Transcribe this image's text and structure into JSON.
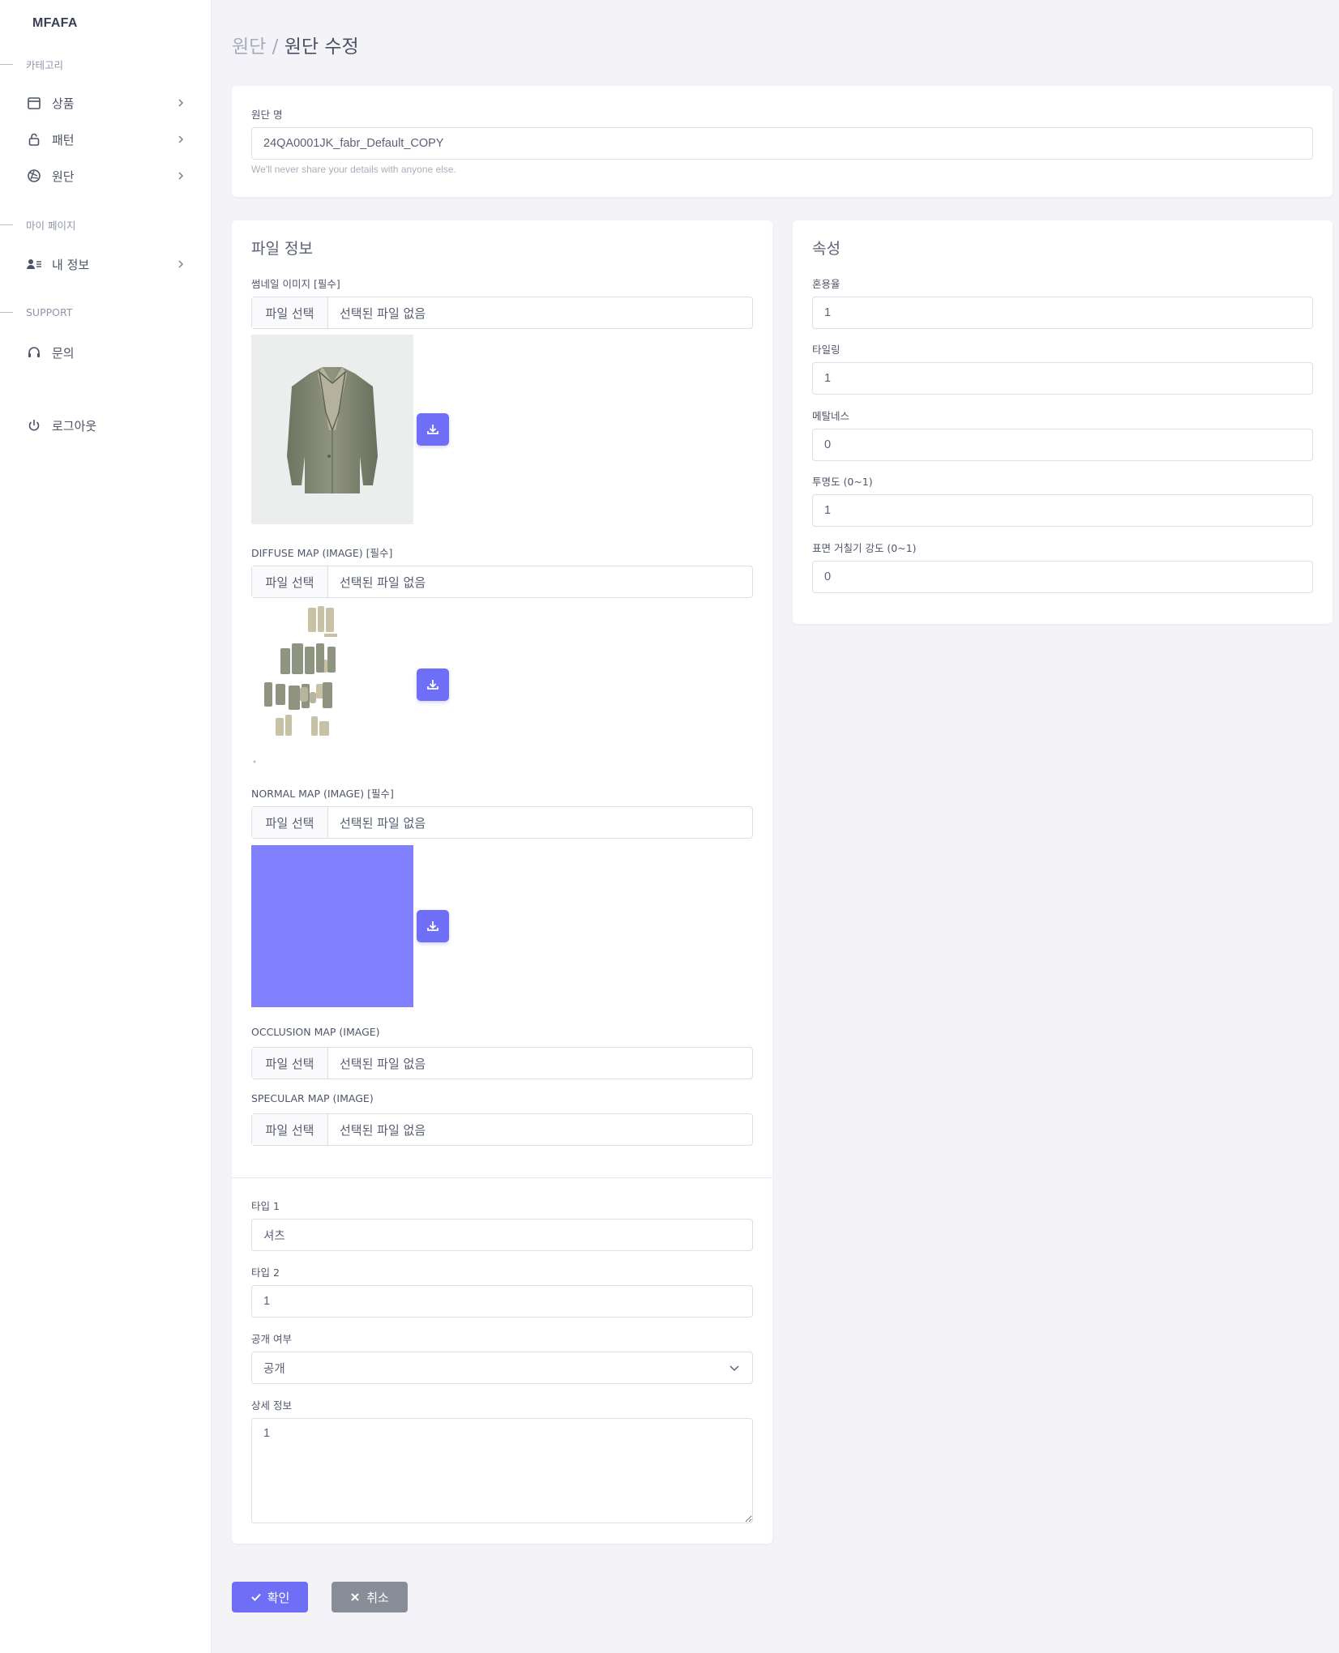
{
  "sidebar": {
    "brand": "MFAFA",
    "sections": {
      "category": "카테고리",
      "mypage": "마이 페이지",
      "support": "SUPPORT"
    },
    "items": {
      "products": "상품",
      "pattern": "패턴",
      "fabric": "원단",
      "my_info": "내 정보",
      "inquiry": "문의",
      "logout": "로그아웃"
    }
  },
  "breadcrumb": {
    "parent": "원단",
    "separator": " / ",
    "current": "원단 수정"
  },
  "fabric_name": {
    "label": "원단 명",
    "value": "24QA0001JK_fabr_Default_COPY",
    "help": "We'll never share your details with anyone else."
  },
  "file_info": {
    "title": "파일 정보",
    "select_label": "파일 선택",
    "no_file": "선택된 파일 없음",
    "thumbnail_label": "썸네일 이미지 [필수]",
    "diffuse_label": "DIFFUSE MAP (IMAGE) [필수]",
    "normal_label": "NORMAL MAP (IMAGE) [필수]",
    "occlusion_label": "OCCLUSION MAP (IMAGE)",
    "specular_label": "SPECULAR MAP (IMAGE)",
    "normal_color": "#8080ff"
  },
  "details": {
    "type1_label": "타입 1",
    "type1_value": "셔츠",
    "type2_label": "타입 2",
    "type2_value": "1",
    "public_label": "공개 여부",
    "public_value": "공개",
    "detail_label": "상세 정보",
    "detail_value": "1"
  },
  "properties": {
    "title": "속성",
    "blend_label": "혼용율",
    "blend_value": "1",
    "tiling_label": "타일링",
    "tiling_value": "1",
    "metalness_label": "메탈네스",
    "metalness_value": "0",
    "opacity_label": "투명도 (0~1)",
    "opacity_value": "1",
    "roughness_label": "표면 거칠기 강도 (0~1)",
    "roughness_value": "0"
  },
  "actions": {
    "confirm": "확인",
    "cancel": "취소"
  },
  "colors": {
    "accent": "#6e6ef7",
    "cancel": "#878e9a"
  }
}
